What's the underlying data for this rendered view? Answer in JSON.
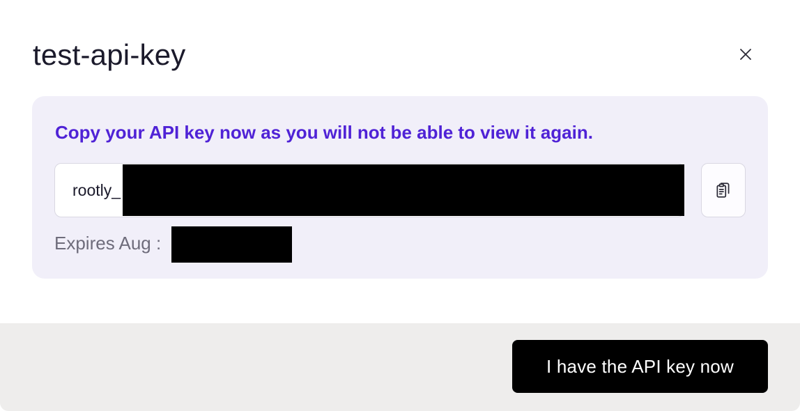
{
  "dialog": {
    "title": "test-api-key"
  },
  "notice": {
    "message": "Copy your API key now as you will not be able to view it again.",
    "key_prefix": "rootly_",
    "expires_prefix": "Expires Aug :"
  },
  "footer": {
    "confirm_label": "I have the API key now"
  },
  "icons": {
    "close": "close-icon",
    "copy": "clipboard-copy-icon"
  },
  "colors": {
    "accent_text": "#4f22d6",
    "panel_background": "#f1eff9",
    "primary_button": "#000000",
    "footer_background": "#eeedec"
  }
}
